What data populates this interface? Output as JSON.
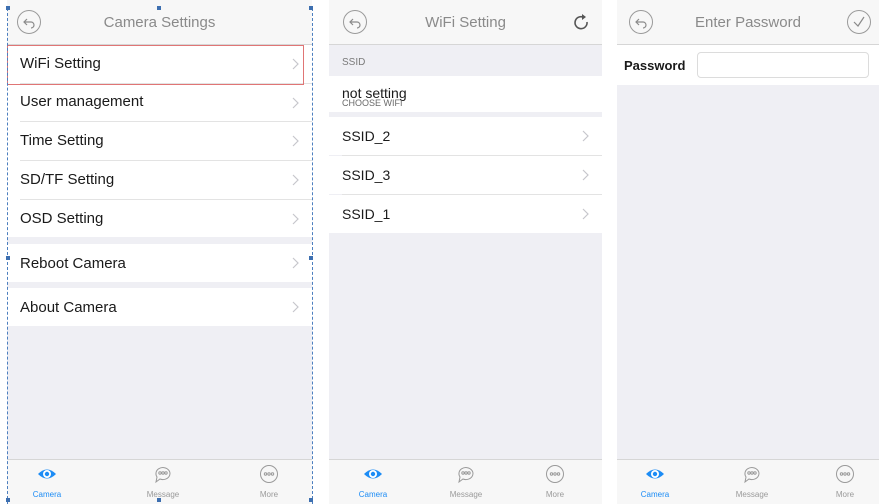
{
  "screen1": {
    "title": "Camera Settings",
    "items": [
      {
        "label": "WiFi Setting"
      },
      {
        "label": "User management"
      },
      {
        "label": "Time Setting"
      },
      {
        "label": "SD/TF Setting"
      },
      {
        "label": "OSD Setting"
      },
      {
        "label": "Reboot Camera"
      },
      {
        "label": "About Camera"
      }
    ]
  },
  "screen2": {
    "title": "WiFi Setting",
    "section_header": "SSID",
    "current_network": "not setting",
    "current_hint": "CHOOSE WIFI",
    "networks": [
      {
        "label": "SSID_2"
      },
      {
        "label": "SSID_3"
      },
      {
        "label": "SSID_1"
      }
    ]
  },
  "screen3": {
    "title": "Enter Password",
    "password_label": "Password",
    "password_value": ""
  },
  "tabs": [
    {
      "label": "Camera"
    },
    {
      "label": "Message"
    },
    {
      "label": "More"
    }
  ],
  "colors": {
    "accent": "#1c8cf5",
    "selection": "#e07575",
    "background": "#efeff4"
  }
}
